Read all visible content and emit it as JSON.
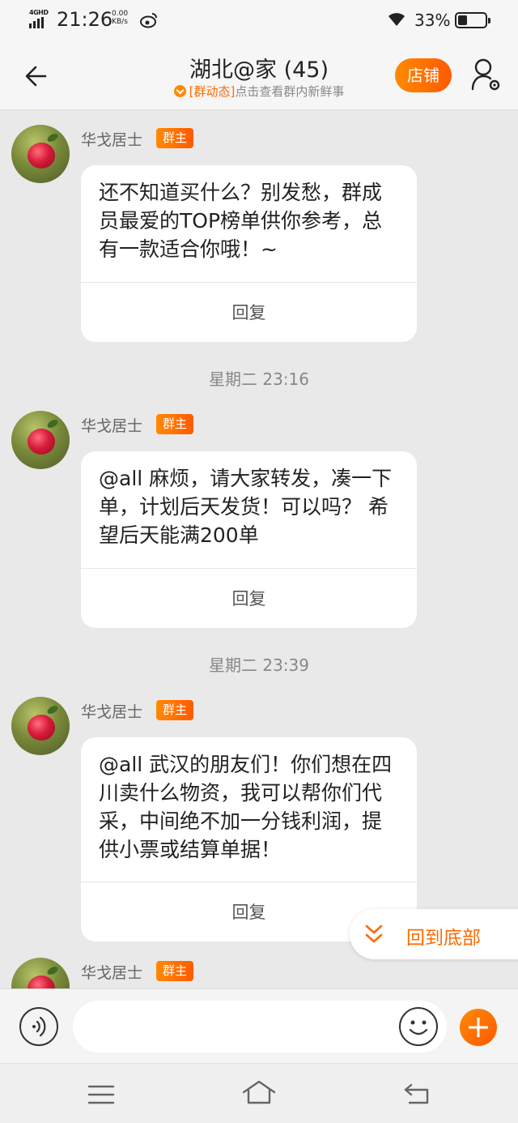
{
  "status_bar": {
    "network": "4GHD",
    "time": "21:26",
    "speed_value": "0.00",
    "speed_unit": "KB/s",
    "battery": "33%",
    "battery_level": 0.33
  },
  "header": {
    "title": "湖北@家 (45)",
    "subtitle_tag": "[群动态]",
    "subtitle_text": "点击查看群内新鲜事",
    "shop_label": "店铺"
  },
  "messages": [
    {
      "sender": "华戈居士",
      "role": "群主",
      "text": "还不知道买什么？别发愁，群成员最爱的TOP榜单供你参考，总有一款适合你哦！~",
      "reply_label": "回复"
    },
    {
      "timestamp": "星期二 23:16",
      "sender": "华戈居士",
      "role": "群主",
      "text": "@all 麻烦，请大家转发，凑一下单，计划后天发货！可以吗？ 希望后天能满200单",
      "reply_label": "回复"
    },
    {
      "timestamp": "星期二 23:39",
      "sender": "华戈居士",
      "role": "群主",
      "text": "@all 武汉的朋友们！你们想在四川卖什么物资，我可以帮你们代采，中间绝不加一分钱利润，提供小票或结算单据！",
      "reply_label": "回复"
    },
    {
      "sender": "华戈居士",
      "role": "群主"
    }
  ],
  "back_to_bottom": "回到底部",
  "input": {
    "placeholder": ""
  },
  "colors": {
    "accent": "#ff6a00",
    "background": "#e9e9e9"
  }
}
